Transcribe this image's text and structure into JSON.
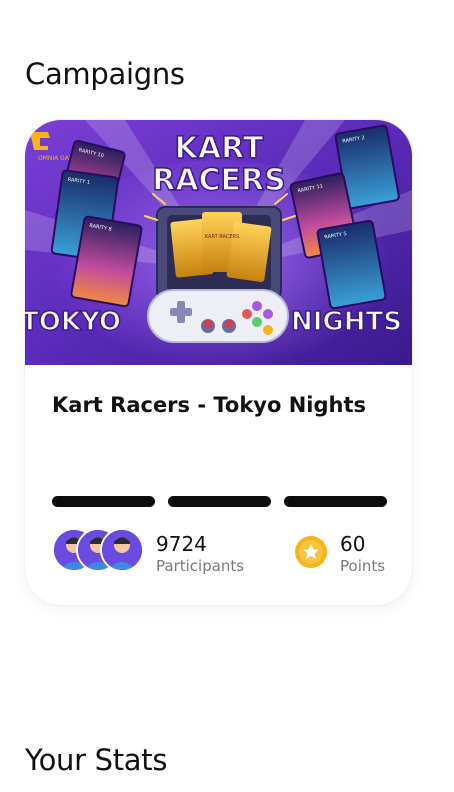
{
  "sections": {
    "campaigns_title": "Campaigns",
    "stats_title": "Your Stats"
  },
  "campaign": {
    "title": "Kart Racers - Tokyo Nights",
    "banner": {
      "logo_text": "OMNIA GAMES",
      "headline_top": "KART",
      "headline_bottom": "RACERS",
      "left_word": "TOKYO",
      "right_word": "NIGHTS",
      "card_labels": [
        "RARITY 10",
        "RARITY 1",
        "RARITY 8",
        "RARITY 2",
        "RARITY 11",
        "RARITY 5"
      ],
      "pack_text": "KART RACERS"
    },
    "progress_segments": 3,
    "participants": {
      "count": "9724",
      "label": "Participants"
    },
    "points": {
      "count": "60",
      "label": "Points",
      "icon": "star-icon"
    },
    "avatar_count": 3
  },
  "colors": {
    "banner_bg": "#5b2fb8",
    "accent_gold": "#f5b41a",
    "progress": "#0c0c0c",
    "muted_text": "#7a7a7a"
  }
}
